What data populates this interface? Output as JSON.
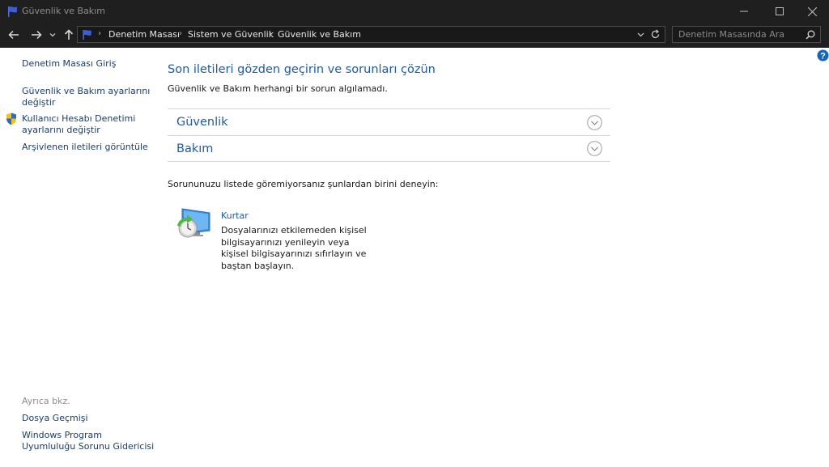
{
  "window": {
    "title": "Güvenlik ve Bakım"
  },
  "breadcrumb": [
    "Denetim Masası",
    "Sistem ve Güvenlik",
    "Güvenlik ve Bakım"
  ],
  "search": {
    "placeholder": "Denetim Masasında Ara"
  },
  "sidebar": {
    "home": "Denetim Masası Giriş",
    "settings": [
      "Güvenlik ve Bakım ayarlarını",
      "değiştir"
    ],
    "uac": [
      "Kullanıcı Hesabı Denetimi",
      "ayarlarını değiştir"
    ],
    "archived": "Arşivlenen iletileri görüntüle",
    "see_also_title": "Ayrıca bkz.",
    "file_history": "Dosya Geçmişi",
    "compat": [
      "Windows Program",
      "Uyumluluğu Sorunu Gidericisi"
    ]
  },
  "main": {
    "heading": "Son iletileri gözden geçirin ve sorunları çözün",
    "status": "Güvenlik ve Bakım herhangi bir sorun algılamadı.",
    "sections": [
      "Güvenlik",
      "Bakım"
    ],
    "try_text": "Sorununuzu listede göremiyorsanız şunlardan birini deneyin:",
    "recovery": {
      "title": "Kurtar",
      "description": "Dosyalarınızı etkilemeden kişisel bilgisayarınızı yenileyin veya kişisel bilgisayarınızı sıfırlayın ve baştan başlayın."
    }
  },
  "icons": [
    "flag-icon",
    "minimize-icon",
    "maximize-icon",
    "close-icon",
    "back-icon",
    "forward-icon",
    "recent-dropdown-icon",
    "up-icon",
    "refresh-icon",
    "search-icon",
    "shield-icon",
    "chevron-down-icon",
    "recovery-icon",
    "help-icon"
  ],
  "colors": {
    "titlebar": "#1f1f1f",
    "link": "#1e5aa8",
    "sidebar_link": "#1a3d6e",
    "help": "#1565c0"
  }
}
